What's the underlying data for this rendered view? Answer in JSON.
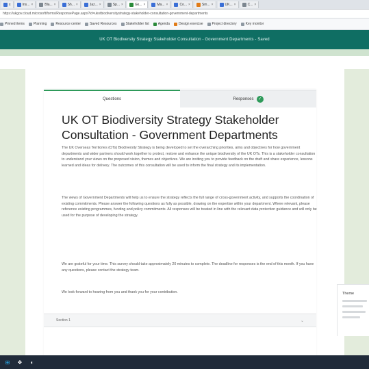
{
  "browser": {
    "tabs": [
      {
        "label": "x",
        "active": false
      },
      {
        "label": "Ins...",
        "active": false
      },
      {
        "label": "Bla...",
        "active": false
      },
      {
        "label": "Sh...",
        "active": false
      },
      {
        "label": "Jaz...",
        "active": false
      },
      {
        "label": "Sp...",
        "active": false
      },
      {
        "label": "Gk...",
        "active": true
      },
      {
        "label": "Ma...",
        "active": false
      },
      {
        "label": "Co...",
        "active": false
      },
      {
        "label": "Sm...",
        "active": false
      },
      {
        "label": "UK...",
        "active": false
      },
      {
        "label": "C...",
        "active": false
      }
    ],
    "url": "https://ukgov.cloud.microsoft/forms/ResponsePage.aspx?id=ukotbiodiversitystrategy-stakeholder-consultation-government-departments",
    "bookmarks": [
      "Pinned items",
      "Planning",
      "Resource center",
      "Saved Resources",
      "Stakeholder list",
      "Agenda",
      "Design exercise",
      "Project directory",
      "Key monitor"
    ]
  },
  "banner": {
    "title": "UK OT Biodiversity Strategy Stakeholder Consultation - Government Departments - Saved"
  },
  "form": {
    "tab_questions": "Questions",
    "tab_responses": "Responses",
    "responses_count": "✓",
    "title": "UK OT Biodiversity Strategy Stakeholder Consultation - Government Departments",
    "paragraph1": "The UK Overseas Territories (OTs) Biodiversity Strategy is being developed to set the overarching priorities, aims and objectives for how government departments and wider partners should work together to protect, restore and enhance the unique biodiversity of the UK OTs. This is a stakeholder consultation to understand your views on the proposed vision, themes and objectives. We are inviting you to provide feedback on the draft and share experience, lessons learned and ideas for delivery. The outcomes of this consultation will be used to inform the final strategy and its implementation.",
    "paragraph2": "The views of Government Departments will help us to ensure the strategy reflects the full range of cross-government activity, and supports the coordination of existing commitments. Please answer the following questions as fully as possible, drawing on the expertise within your department. Where relevant, please reference existing programmes, funding and policy commitments. All responses will be treated in line with the relevant data protection guidance and will only be used for the purpose of developing the strategy.",
    "paragraph3": "We are grateful for your time. This survey should take approximately 20 minutes to complete. The deadline for responses is the end of this month. If you have any questions, please contact the strategy team.",
    "paragraph4": "We look forward to hearing from you and thank you for your contribution.",
    "section_select": "Section 1",
    "side_panel_title": "Theme"
  },
  "colors": {
    "banner": "#0f6e63",
    "accent": "#2e9a5a",
    "side_panels": "#e3ecdc",
    "taskbar": "#202b3a"
  },
  "taskbar": {
    "icons": [
      "windows-start-icon",
      "task-view-icon",
      "edge-browser-icon"
    ]
  }
}
